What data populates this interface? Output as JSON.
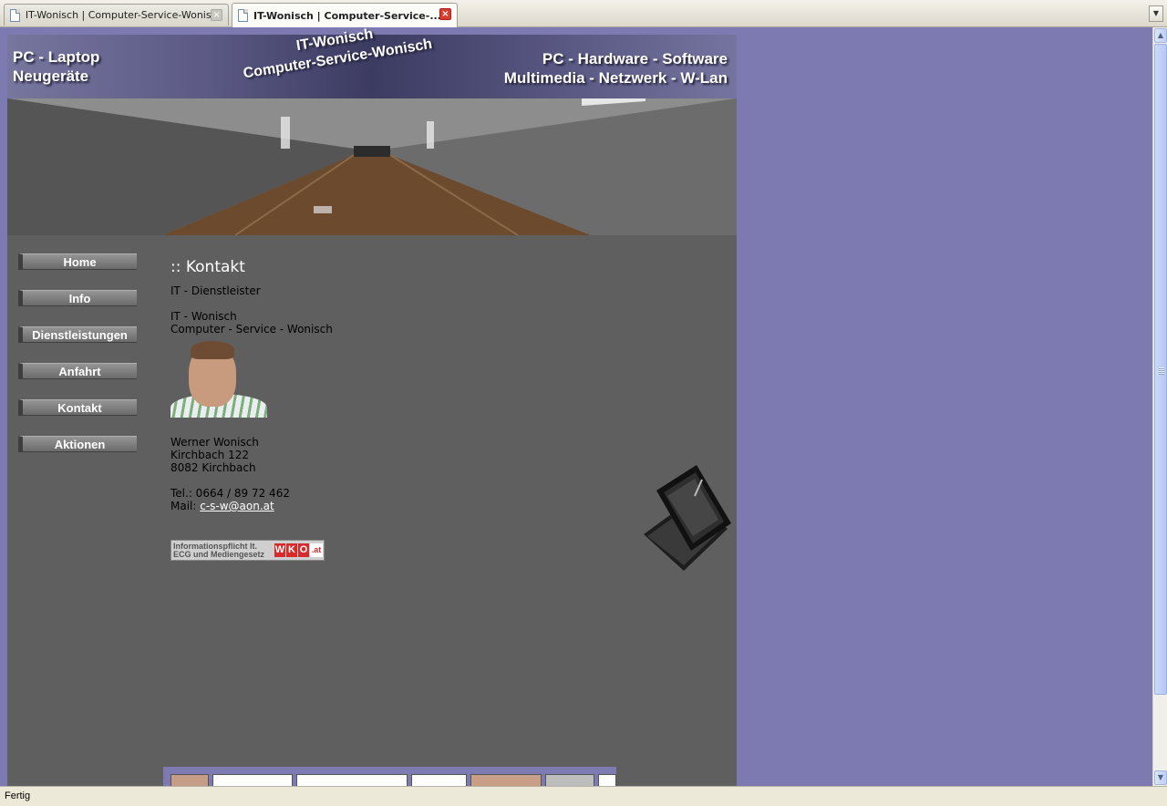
{
  "browser": {
    "tabs": [
      {
        "label": "IT-Wonisch | Computer-Service-Wonisc...",
        "active": false
      },
      {
        "label": "IT-Wonisch | Computer-Service-...",
        "active": true
      }
    ],
    "close_glyph": "×",
    "dropdown_glyph": "▼",
    "status": "Fertig",
    "scroll": {
      "up_glyph": "▲",
      "down_glyph": "▼"
    }
  },
  "header": {
    "left_line1": "PC - Laptop",
    "left_line2": "Neugeräte",
    "center_line1": "IT-Wonisch",
    "center_line2": "Computer-Service-Wonisch",
    "right_line1": "PC - Hardware - Software",
    "right_line2": "Multimedia - Netzwerk - W-Lan"
  },
  "nav": {
    "items": [
      "Home",
      "Info",
      "Dienstleistungen",
      "Anfahrt",
      "Kontakt",
      "Aktionen"
    ]
  },
  "content": {
    "title": ":: Kontakt",
    "subtitle": "IT - Dienstleister",
    "company_line1": "IT - Wonisch",
    "company_line2": "Computer - Service - Wonisch",
    "name": "Werner Wonisch",
    "street": "Kirchbach 122",
    "city": "8082 Kirchbach",
    "tel": "Tel.: 0664 / 89 72 462",
    "mail_label": "Mail: ",
    "mail": "c-s-w@aon.at",
    "wko_text": "Informationspflicht lt.\nECG und Mediengesetz",
    "wko_letters": [
      "W",
      "K",
      "O",
      ".at"
    ]
  },
  "colors": {
    "page_background": "#7d7ab1",
    "site_background": "#5f5f5f",
    "link": "#ffffff",
    "wko_red": "#d72a2a"
  }
}
